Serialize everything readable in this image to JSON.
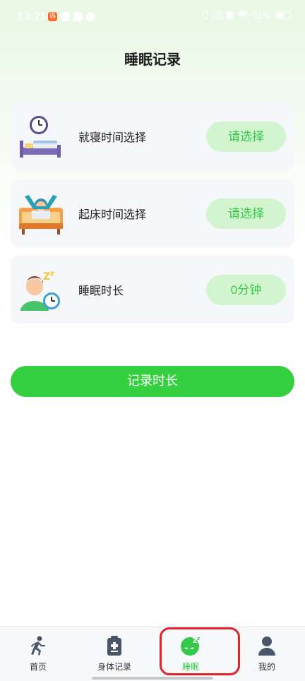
{
  "status_bar": {
    "time": "13:25",
    "net_speed": "0.20\nKB/s",
    "battery": "51%"
  },
  "page": {
    "title": "睡眠记录"
  },
  "cards": [
    {
      "label": "就寝时间选择",
      "action": "请选择",
      "icon": "bed-clock-icon"
    },
    {
      "label": "起床时间选择",
      "action": "请选择",
      "icon": "wake-up-icon"
    },
    {
      "label": "睡眠时长",
      "action": "0分钟",
      "icon": "sleep-duration-icon"
    }
  ],
  "record_button": {
    "label": "记录时长"
  },
  "tabs": [
    {
      "label": "首页",
      "icon": "running-person-icon",
      "active": false
    },
    {
      "label": "身体记录",
      "icon": "clipboard-plus-icon",
      "active": false
    },
    {
      "label": "睡眠",
      "icon": "sleep-zzz-icon",
      "active": true
    },
    {
      "label": "我的",
      "icon": "user-icon",
      "active": false
    }
  ],
  "colors": {
    "accent": "#35d03f",
    "pill_bg": "#d2f5cf",
    "pill_text": "#35c94a",
    "highlight": "#e0232a"
  }
}
